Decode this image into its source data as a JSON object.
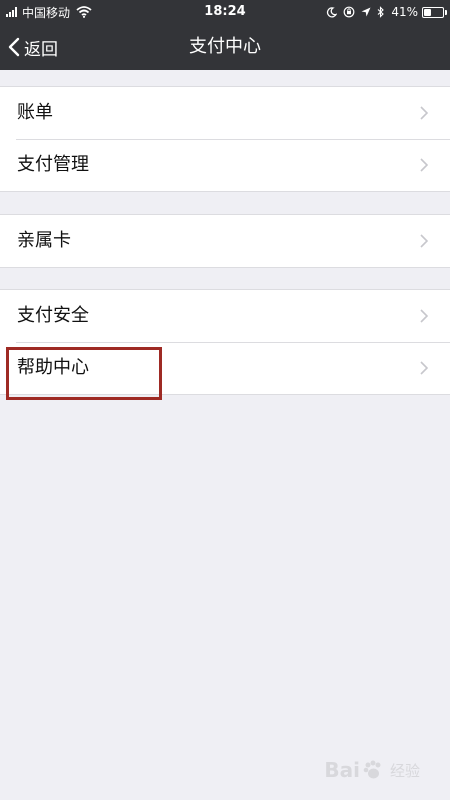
{
  "status_bar": {
    "carrier": "中国移动",
    "time": "18:24",
    "battery": "41%",
    "battery_level": 0.41,
    "icons": [
      "signal-icon",
      "wifi-icon",
      "moon-icon",
      "rotation-lock-icon",
      "location-icon",
      "bluetooth-icon",
      "battery-icon"
    ]
  },
  "nav": {
    "back_label": "返回",
    "title": "支付中心"
  },
  "groups": [
    {
      "items": [
        {
          "label": "账单"
        },
        {
          "label": "支付管理"
        }
      ]
    },
    {
      "items": [
        {
          "label": "亲属卡"
        }
      ]
    },
    {
      "items": [
        {
          "label": "支付安全"
        },
        {
          "label": "帮助中心"
        }
      ]
    }
  ],
  "watermark": {
    "text_left": "Bai",
    "text_right": "经验"
  },
  "colors": {
    "nav_background": "#333438",
    "page_background": "#efeff4",
    "highlight_border": "#9e2a24"
  }
}
